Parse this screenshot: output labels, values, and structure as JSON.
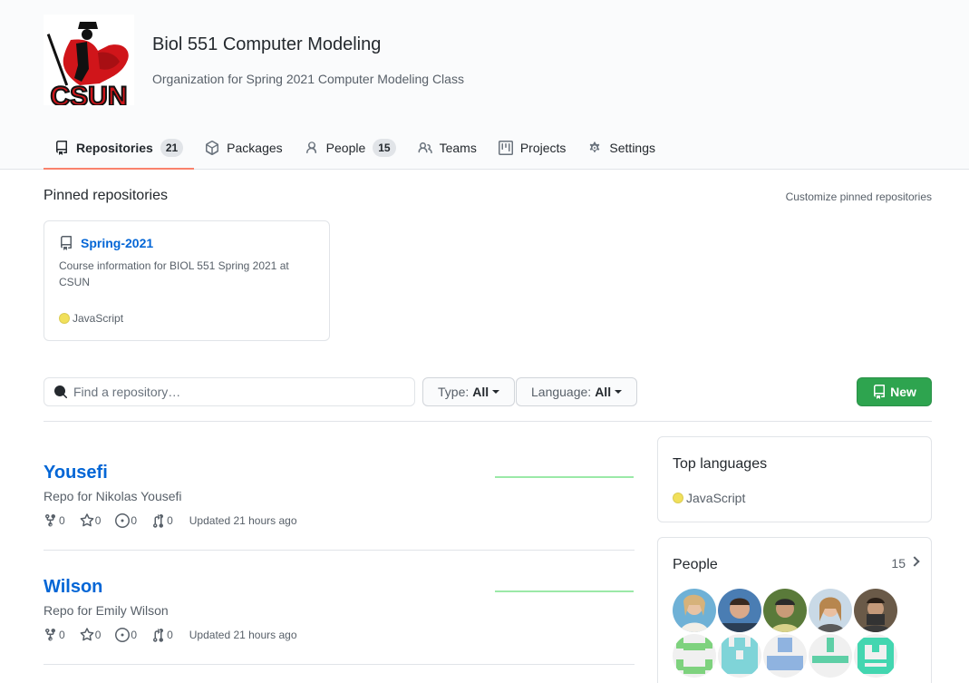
{
  "org": {
    "name": "Biol 551 Computer Modeling",
    "description": "Organization for Spring 2021 Computer Modeling Class",
    "logo_text": "CSUN"
  },
  "tabs": [
    {
      "label": "Repositories",
      "count": "21",
      "icon": "repo-icon",
      "selected": true
    },
    {
      "label": "Packages",
      "icon": "package-icon"
    },
    {
      "label": "People",
      "count": "15",
      "icon": "person-icon"
    },
    {
      "label": "Teams",
      "icon": "people-icon"
    },
    {
      "label": "Projects",
      "icon": "project-icon"
    },
    {
      "label": "Settings",
      "icon": "gear-icon"
    }
  ],
  "pinned": {
    "title": "Pinned repositories",
    "customize_label": "Customize pinned repositories",
    "repo": {
      "name": "Spring-2021",
      "description": "Course information for BIOL 551 Spring 2021 at CSUN",
      "language": "JavaScript",
      "language_color": "#f1e05a"
    }
  },
  "filters": {
    "search_placeholder": "Find a repository…",
    "type_label": "Type:",
    "type_value": "All",
    "language_label": "Language:",
    "language_value": "All",
    "new_label": "New"
  },
  "repos": [
    {
      "name": "Yousefi",
      "description": "Repo for Nikolas Yousefi",
      "forks": "0",
      "stars": "0",
      "issues": "0",
      "prs": "0",
      "updated": "Updated 21 hours ago"
    },
    {
      "name": "Wilson",
      "description": "Repo for Emily Wilson",
      "forks": "0",
      "stars": "0",
      "issues": "0",
      "prs": "0",
      "updated": "Updated 21 hours ago"
    }
  ],
  "sidebar": {
    "top_languages_title": "Top languages",
    "top_language": "JavaScript",
    "people_title": "People",
    "people_count": "15"
  },
  "colors": {
    "accent_underline": "#f9826c",
    "link": "#0366d6",
    "new_button": "#2ea44f",
    "activity_graph": "#9be9a8"
  }
}
